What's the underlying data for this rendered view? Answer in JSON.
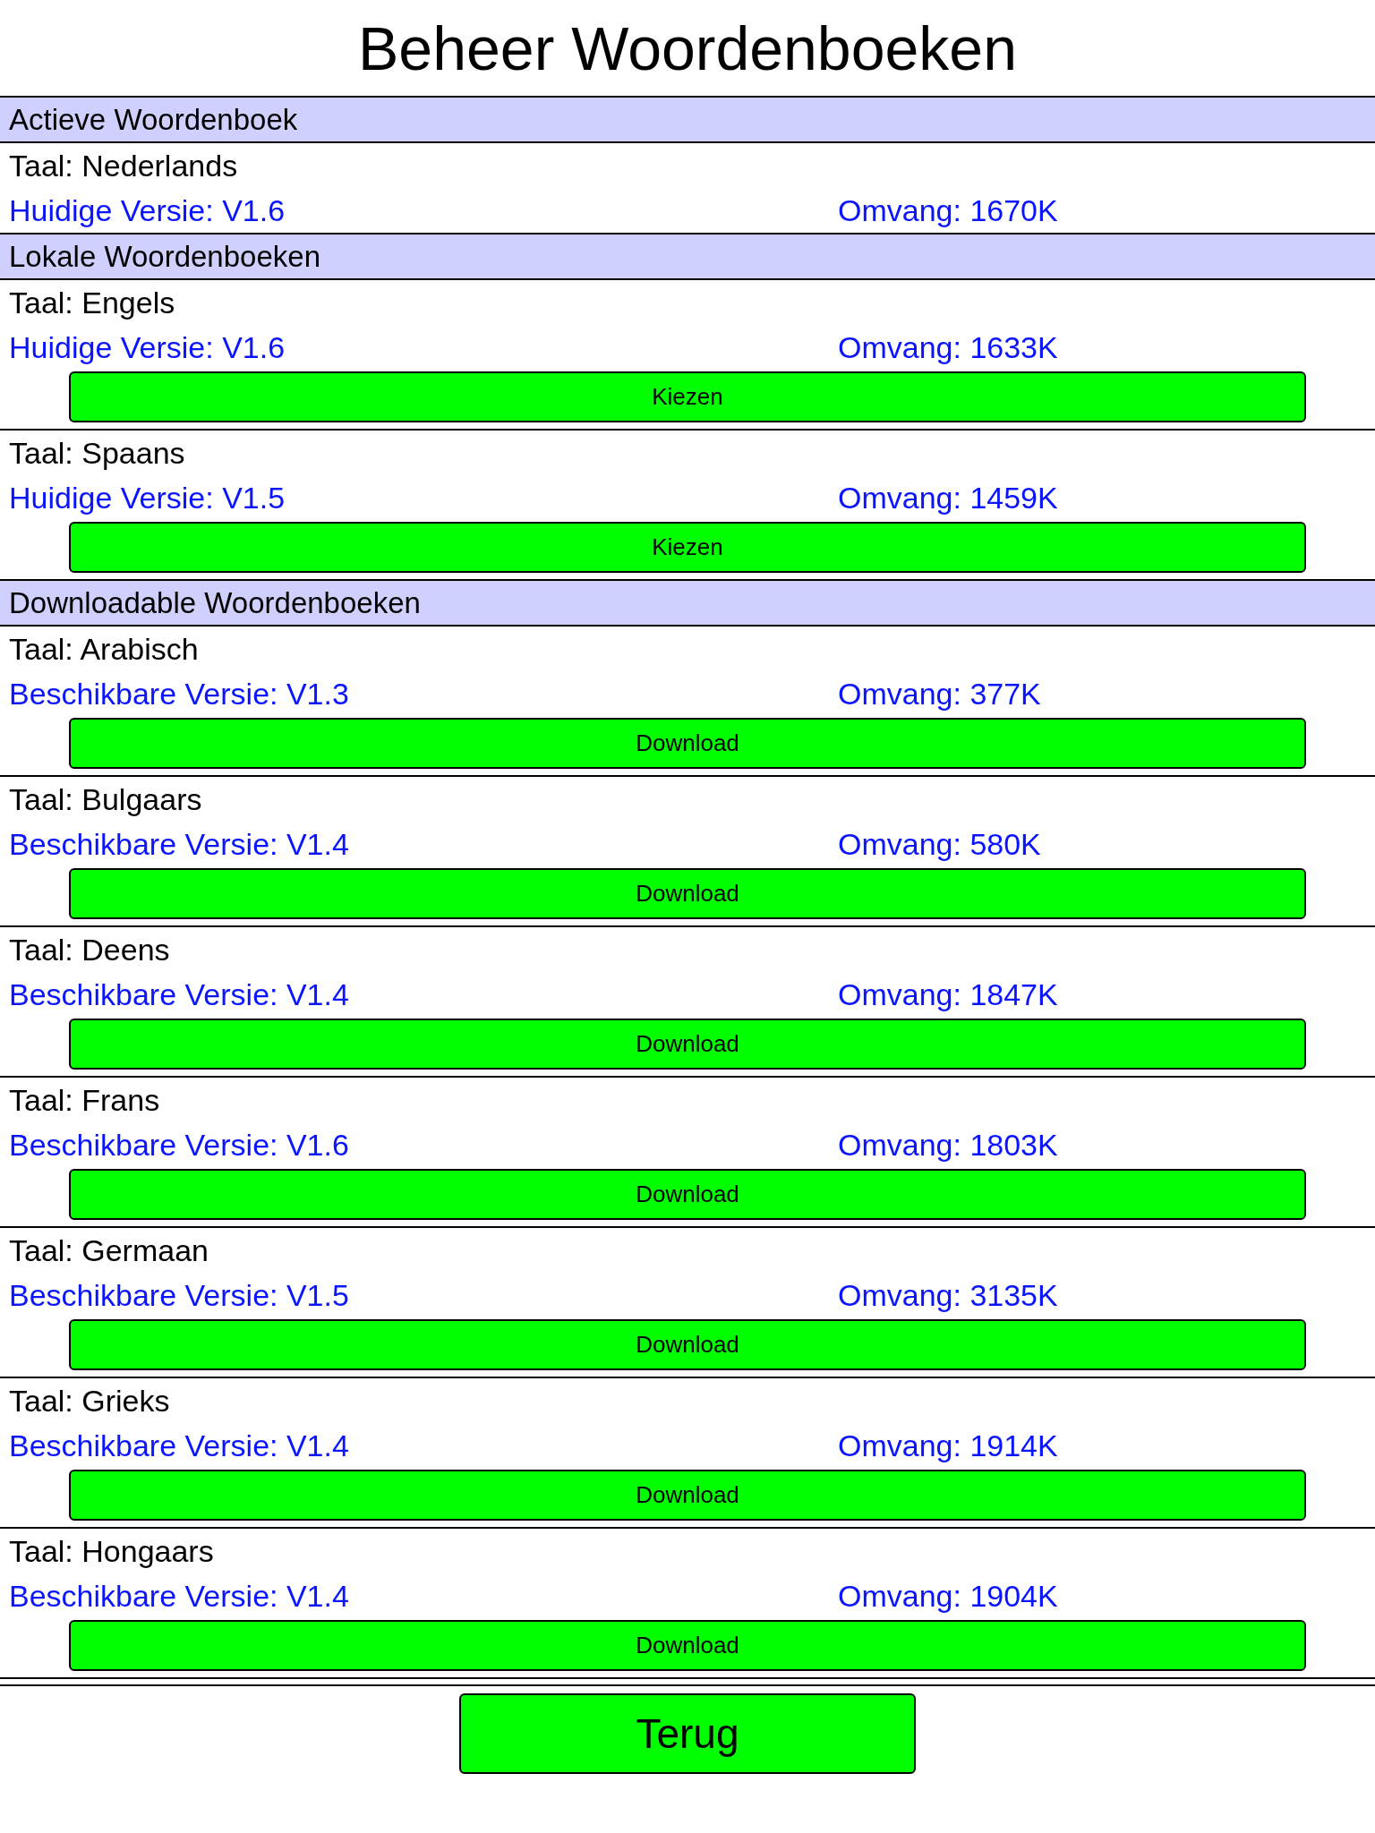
{
  "title": "Beheer Woordenboeken",
  "sections": [
    {
      "title": "Actieve Woordenboek",
      "items": [
        {
          "language": "Taal: Nederlands",
          "version": "Huidige Versie: V1.6",
          "size": "Omvang: 1670K"
        }
      ]
    },
    {
      "title": "Lokale Woordenboeken",
      "items": [
        {
          "language": "Taal: Engels",
          "version": "Huidige Versie: V1.6",
          "size": "Omvang: 1633K",
          "button": "Kiezen"
        },
        {
          "language": "Taal: Spaans",
          "version": "Huidige Versie: V1.5",
          "size": "Omvang: 1459K",
          "button": "Kiezen"
        }
      ]
    },
    {
      "title": "Downloadable Woordenboeken",
      "items": [
        {
          "language": "Taal: Arabisch",
          "version": "Beschikbare Versie: V1.3",
          "size": "Omvang: 377K",
          "button": "Download"
        },
        {
          "language": "Taal: Bulgaars",
          "version": "Beschikbare Versie: V1.4",
          "size": "Omvang: 580K",
          "button": "Download"
        },
        {
          "language": "Taal: Deens",
          "version": "Beschikbare Versie: V1.4",
          "size": "Omvang: 1847K",
          "button": "Download"
        },
        {
          "language": "Taal: Frans",
          "version": "Beschikbare Versie: V1.6",
          "size": "Omvang: 1803K",
          "button": "Download"
        },
        {
          "language": "Taal: Germaan",
          "version": "Beschikbare Versie: V1.5",
          "size": "Omvang: 3135K",
          "button": "Download"
        },
        {
          "language": "Taal: Grieks",
          "version": "Beschikbare Versie: V1.4",
          "size": "Omvang: 1914K",
          "button": "Download"
        },
        {
          "language": "Taal: Hongaars",
          "version": "Beschikbare Versie: V1.4",
          "size": "Omvang: 1904K",
          "button": "Download"
        }
      ]
    }
  ],
  "back_button": "Terug"
}
